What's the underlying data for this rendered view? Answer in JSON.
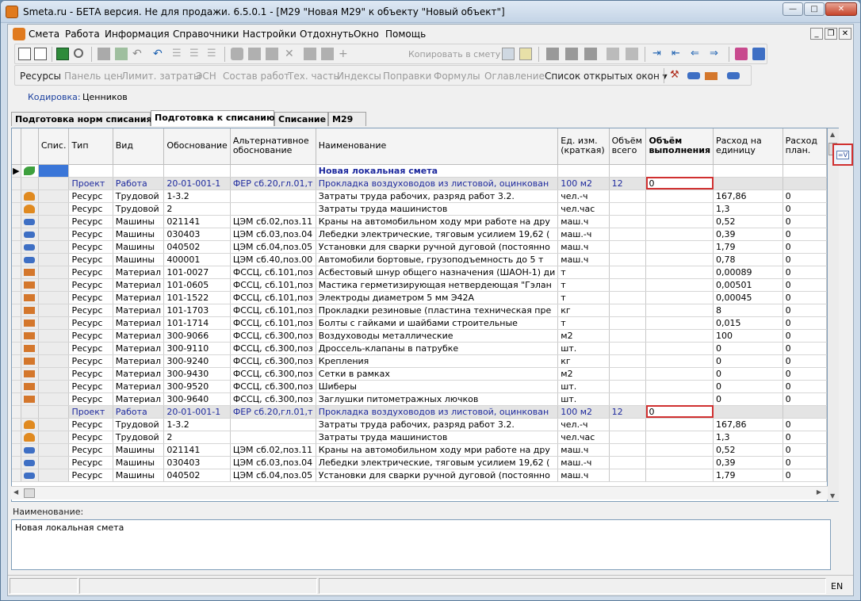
{
  "window": {
    "title": "Smeta.ru - БЕТА версия. Не для продажи.  6.5.0.1   - [М29 \"Новая М29\" к объекту \"Новый объект\"]"
  },
  "menu": [
    "Смета",
    "Работа",
    "Информация",
    "Справочники",
    "Настройки",
    "Отдохнуть",
    "Окно",
    "Помощь"
  ],
  "toolbar1": {
    "copy_label": "Копировать в смету"
  },
  "toolbar2": {
    "links": [
      "Ресурсы",
      "Панель цен",
      "Лимит. затраты",
      "ЭСН",
      "Состав работ",
      "Тех. часть",
      "Индексы",
      "Поправки",
      "Формулы",
      "Оглавление"
    ],
    "open_windows": "Список открытых окон"
  },
  "kodirovka": {
    "label": "Кодировка:",
    "value": "Ценников"
  },
  "tabs": [
    "Подготовка норм списания",
    "Подготовка к списанию",
    "Списание",
    "М29"
  ],
  "grid": {
    "headers": [
      "Спис.",
      "Тип",
      "Вид",
      "Обоснование",
      "Альтернативное обоснование",
      "Наименование",
      "Ед. изм. (краткая)",
      "Объём всего",
      "Объём выполнения",
      "Расход на единицу",
      "Расход план."
    ],
    "first_row_name": "Новая локальная смета",
    "rows": [
      {
        "kind": "proj",
        "icon": "",
        "type": "Проект",
        "vid": "Работа",
        "obosn": "20-01-001-1",
        "alt": "ФЕР сб.20,гл.01,т",
        "name": "Прокладка воздуховодов из листовой, оцинкован",
        "unit": "100 м2",
        "vol": "12",
        "exec": "0",
        "rash": "",
        "plan": ""
      },
      {
        "kind": "res",
        "icon": "worker",
        "type": "Ресурс",
        "vid": "Трудовой",
        "obosn": "1-3.2",
        "alt": "",
        "name": "Затраты труда рабочих, разряд работ 3.2.",
        "unit": "чел.-ч",
        "vol": "",
        "exec": "",
        "rash": "167,86",
        "plan": "0"
      },
      {
        "kind": "res",
        "icon": "worker",
        "type": "Ресурс",
        "vid": "Трудовой",
        "obosn": "2",
        "alt": "",
        "name": "Затраты труда машинистов",
        "unit": "чел.час",
        "vol": "",
        "exec": "",
        "rash": "1,3",
        "plan": "0"
      },
      {
        "kind": "res",
        "icon": "truck",
        "type": "Ресурс",
        "vid": "Машины",
        "obosn": "021141",
        "alt": "ЦЭМ  сб.02,поз.11",
        "name": "Краны на автомобильном ходу мри работе на дру",
        "unit": "маш.ч",
        "vol": "",
        "exec": "",
        "rash": "0,52",
        "plan": "0"
      },
      {
        "kind": "res",
        "icon": "truck",
        "type": "Ресурс",
        "vid": "Машины",
        "obosn": "030403",
        "alt": "ЦЭМ  сб.03,поз.04",
        "name": "Лебедки электрические, тяговым усилием 19,62 (",
        "unit": "маш.-ч",
        "vol": "",
        "exec": "",
        "rash": "0,39",
        "plan": "0"
      },
      {
        "kind": "res",
        "icon": "truck",
        "type": "Ресурс",
        "vid": "Машины",
        "obosn": "040502",
        "alt": "ЦЭМ  сб.04,поз.05",
        "name": "Установки для сварки ручной дуговой (постоянно",
        "unit": "маш.ч",
        "vol": "",
        "exec": "",
        "rash": "1,79",
        "plan": "0"
      },
      {
        "kind": "res",
        "icon": "truck",
        "type": "Ресурс",
        "vid": "Машины",
        "obosn": "400001",
        "alt": "ЦЭМ  сб.40,поз.00",
        "name": "Автомобили бортовые, грузоподъемность до 5 т",
        "unit": "маш.ч",
        "vol": "",
        "exec": "",
        "rash": "0,78",
        "plan": "0"
      },
      {
        "kind": "res",
        "icon": "brick",
        "type": "Ресурс",
        "vid": "Материал",
        "obosn": "101-0027",
        "alt": "ФССЦ, сб.101,поз",
        "name": "Асбестовый шнур общего назначения (ШАОН-1) ди",
        "unit": "т",
        "vol": "",
        "exec": "",
        "rash": "0,00089",
        "plan": "0"
      },
      {
        "kind": "res",
        "icon": "brick",
        "type": "Ресурс",
        "vid": "Материал",
        "obosn": "101-0605",
        "alt": "ФССЦ, сб.101,поз",
        "name": "Мастика герметизирующая нетвердеющая \"Гэлан",
        "unit": "т",
        "vol": "",
        "exec": "",
        "rash": "0,00501",
        "plan": "0"
      },
      {
        "kind": "res",
        "icon": "brick",
        "type": "Ресурс",
        "vid": "Материал",
        "obosn": "101-1522",
        "alt": "ФССЦ, сб.101,поз",
        "name": "Электроды диаметром 5 мм Э42А",
        "unit": "т",
        "vol": "",
        "exec": "",
        "rash": "0,00045",
        "plan": "0"
      },
      {
        "kind": "res",
        "icon": "brick",
        "type": "Ресурс",
        "vid": "Материал",
        "obosn": "101-1703",
        "alt": "ФССЦ, сб.101,поз",
        "name": "Прокладки резиновые (пластина техническая пре",
        "unit": "кг",
        "vol": "",
        "exec": "",
        "rash": "8",
        "plan": "0"
      },
      {
        "kind": "res",
        "icon": "brick",
        "type": "Ресурс",
        "vid": "Материал",
        "obosn": "101-1714",
        "alt": "ФССЦ, сб.101,поз",
        "name": "Болты с гайками и шайбами строительные",
        "unit": "т",
        "vol": "",
        "exec": "",
        "rash": "0,015",
        "plan": "0"
      },
      {
        "kind": "res",
        "icon": "brick",
        "type": "Ресурс",
        "vid": "Материал",
        "obosn": "300-9066",
        "alt": "ФССЦ, сб.300,поз",
        "name": "Воздуховоды металлические",
        "unit": "м2",
        "vol": "",
        "exec": "",
        "rash": "100",
        "plan": "0"
      },
      {
        "kind": "res",
        "icon": "brick",
        "type": "Ресурс",
        "vid": "Материал",
        "obosn": "300-9110",
        "alt": "ФССЦ, сб.300,поз",
        "name": "Дроссель-клапаны в патрубке",
        "unit": "шт.",
        "vol": "",
        "exec": "",
        "rash": "0",
        "plan": "0"
      },
      {
        "kind": "res",
        "icon": "brick",
        "type": "Ресурс",
        "vid": "Материал",
        "obosn": "300-9240",
        "alt": "ФССЦ, сб.300,поз",
        "name": "Крепления",
        "unit": "кг",
        "vol": "",
        "exec": "",
        "rash": "0",
        "plan": "0"
      },
      {
        "kind": "res",
        "icon": "brick",
        "type": "Ресурс",
        "vid": "Материал",
        "obosn": "300-9430",
        "alt": "ФССЦ, сб.300,поз",
        "name": "Сетки в рамках",
        "unit": "м2",
        "vol": "",
        "exec": "",
        "rash": "0",
        "plan": "0"
      },
      {
        "kind": "res",
        "icon": "brick",
        "type": "Ресурс",
        "vid": "Материал",
        "obosn": "300-9520",
        "alt": "ФССЦ, сб.300,поз",
        "name": "Шиберы",
        "unit": "шт.",
        "vol": "",
        "exec": "",
        "rash": "0",
        "plan": "0"
      },
      {
        "kind": "res",
        "icon": "brick",
        "type": "Ресурс",
        "vid": "Материал",
        "obosn": "300-9640",
        "alt": "ФССЦ, сб.300,поз",
        "name": "Заглушки питометражных лючков",
        "unit": "шт.",
        "vol": "",
        "exec": "",
        "rash": "0",
        "plan": "0"
      },
      {
        "kind": "proj",
        "icon": "",
        "type": "Проект",
        "vid": "Работа",
        "obosn": "20-01-001-1",
        "alt": "ФЕР сб.20,гл.01,т",
        "name": "Прокладка воздуховодов из листовой, оцинкован",
        "unit": "100 м2",
        "vol": "12",
        "exec": "0",
        "rash": "",
        "plan": ""
      },
      {
        "kind": "res",
        "icon": "worker",
        "type": "Ресурс",
        "vid": "Трудовой",
        "obosn": "1-3.2",
        "alt": "",
        "name": "Затраты труда рабочих, разряд работ 3.2.",
        "unit": "чел.-ч",
        "vol": "",
        "exec": "",
        "rash": "167,86",
        "plan": "0"
      },
      {
        "kind": "res",
        "icon": "worker",
        "type": "Ресурс",
        "vid": "Трудовой",
        "obosn": "2",
        "alt": "",
        "name": "Затраты труда машинистов",
        "unit": "чел.час",
        "vol": "",
        "exec": "",
        "rash": "1,3",
        "plan": "0"
      },
      {
        "kind": "res",
        "icon": "truck",
        "type": "Ресурс",
        "vid": "Машины",
        "obosn": "021141",
        "alt": "ЦЭМ  сб.02,поз.11",
        "name": "Краны на автомобильном ходу мри работе на дру",
        "unit": "маш.ч",
        "vol": "",
        "exec": "",
        "rash": "0,52",
        "plan": "0"
      },
      {
        "kind": "res",
        "icon": "truck",
        "type": "Ресурс",
        "vid": "Машины",
        "obosn": "030403",
        "alt": "ЦЭМ  сб.03,поз.04",
        "name": "Лебедки электрические, тяговым усилием 19,62 (",
        "unit": "маш.-ч",
        "vol": "",
        "exec": "",
        "rash": "0,39",
        "plan": "0"
      },
      {
        "kind": "res",
        "icon": "truck",
        "type": "Ресурс",
        "vid": "Машины",
        "obosn": "040502",
        "alt": "ЦЭМ  сб.04,поз.05",
        "name": "Установки для сварки ручной дуговой (постоянно",
        "unit": "маш.ч",
        "vol": "",
        "exec": "",
        "rash": "1,79",
        "plan": "0"
      }
    ]
  },
  "name_panel": {
    "label": "Наименование:",
    "value": "Новая локальная смета"
  },
  "status": {
    "lang": "EN"
  },
  "colors": {
    "project_text": "#1e2a9e",
    "highlight_border": "#d03030"
  }
}
